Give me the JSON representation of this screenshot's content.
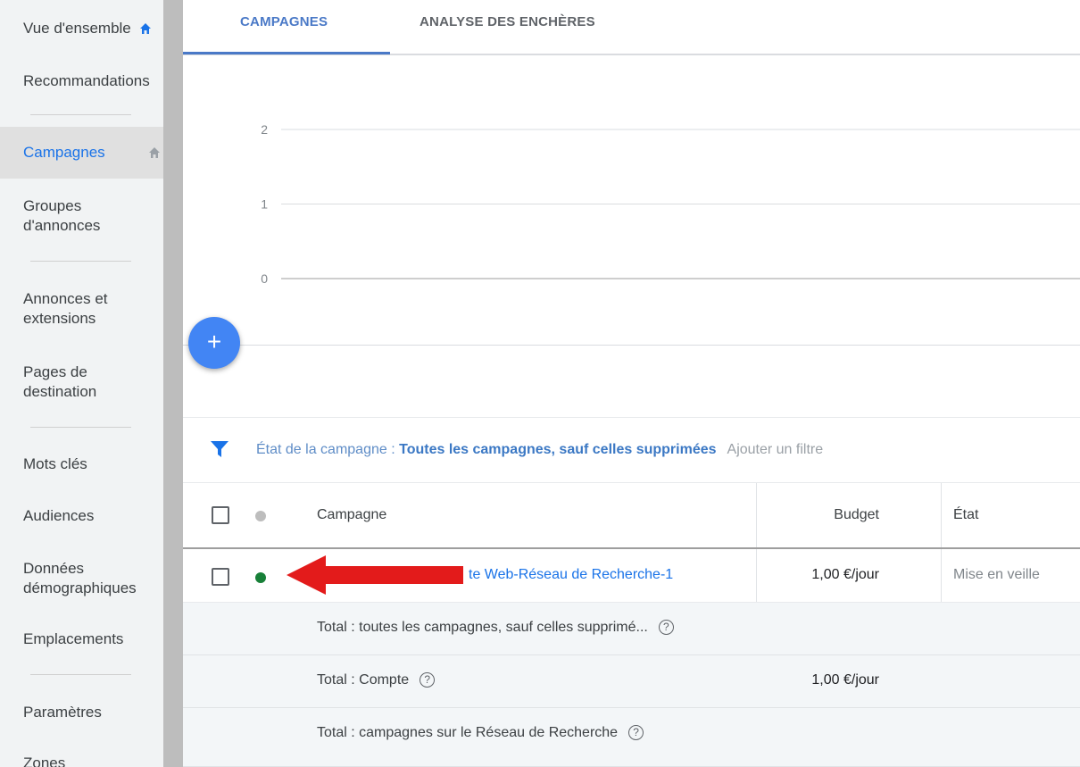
{
  "sidebar": {
    "items": [
      {
        "label": "Vue d'ensemble"
      },
      {
        "label": "Recommandations"
      },
      {
        "label": "Campagnes"
      },
      {
        "label": "Groupes d'annonces",
        "line1": "Groupes",
        "line2": "d'annonces"
      },
      {
        "label": "Annonces et extensions",
        "line1": "Annonces et",
        "line2": "extensions"
      },
      {
        "label": "Pages de destination",
        "line1": "Pages de",
        "line2": "destination"
      },
      {
        "label": "Mots clés"
      },
      {
        "label": "Audiences"
      },
      {
        "label": "Données démographiques",
        "line1": "Données",
        "line2": "démographiques"
      },
      {
        "label": "Emplacements"
      },
      {
        "label": "Paramètres"
      },
      {
        "label": "Zones"
      }
    ],
    "active_item": "Campagnes"
  },
  "tabs": [
    {
      "label": "CAMPAGNES",
      "active": true
    },
    {
      "label": "ANALYSE DES ENCHÈRES",
      "active": false
    }
  ],
  "chart_data": {
    "type": "line",
    "title": "",
    "xlabel": "",
    "ylabel": "",
    "y_ticks": [
      "2",
      "1",
      "0"
    ],
    "ylim": [
      0,
      2
    ],
    "series": [],
    "grid": true
  },
  "fab": {
    "icon": "plus-icon",
    "symbol": "+"
  },
  "filter": {
    "label": "État de la campagne : ",
    "value": "Toutes les campagnes, sauf celles supprimées",
    "add_filter": "Ajouter un filtre"
  },
  "table": {
    "headers": {
      "campaign": "Campagne",
      "budget": "Budget",
      "status": "État"
    },
    "rows": [
      {
        "campaign": "te Web-Réseau de Recherche-1",
        "budget": "1,00 €/jour",
        "status": "Mise en veille",
        "status_color": "#188038"
      }
    ],
    "totals": [
      {
        "label": "Total : toutes les campagnes, sauf celles supprimé...",
        "budget": ""
      },
      {
        "label": "Total : Compte",
        "budget": "1,00 €/jour"
      },
      {
        "label": "Total : campagnes sur le Réseau de Recherche",
        "budget": ""
      }
    ]
  },
  "colors": {
    "accent": "#1a73e8",
    "fab": "#4285f4",
    "arrow": "#e31b1b",
    "status_dot_enabled": "#188038"
  },
  "icons": {
    "help": "?"
  }
}
